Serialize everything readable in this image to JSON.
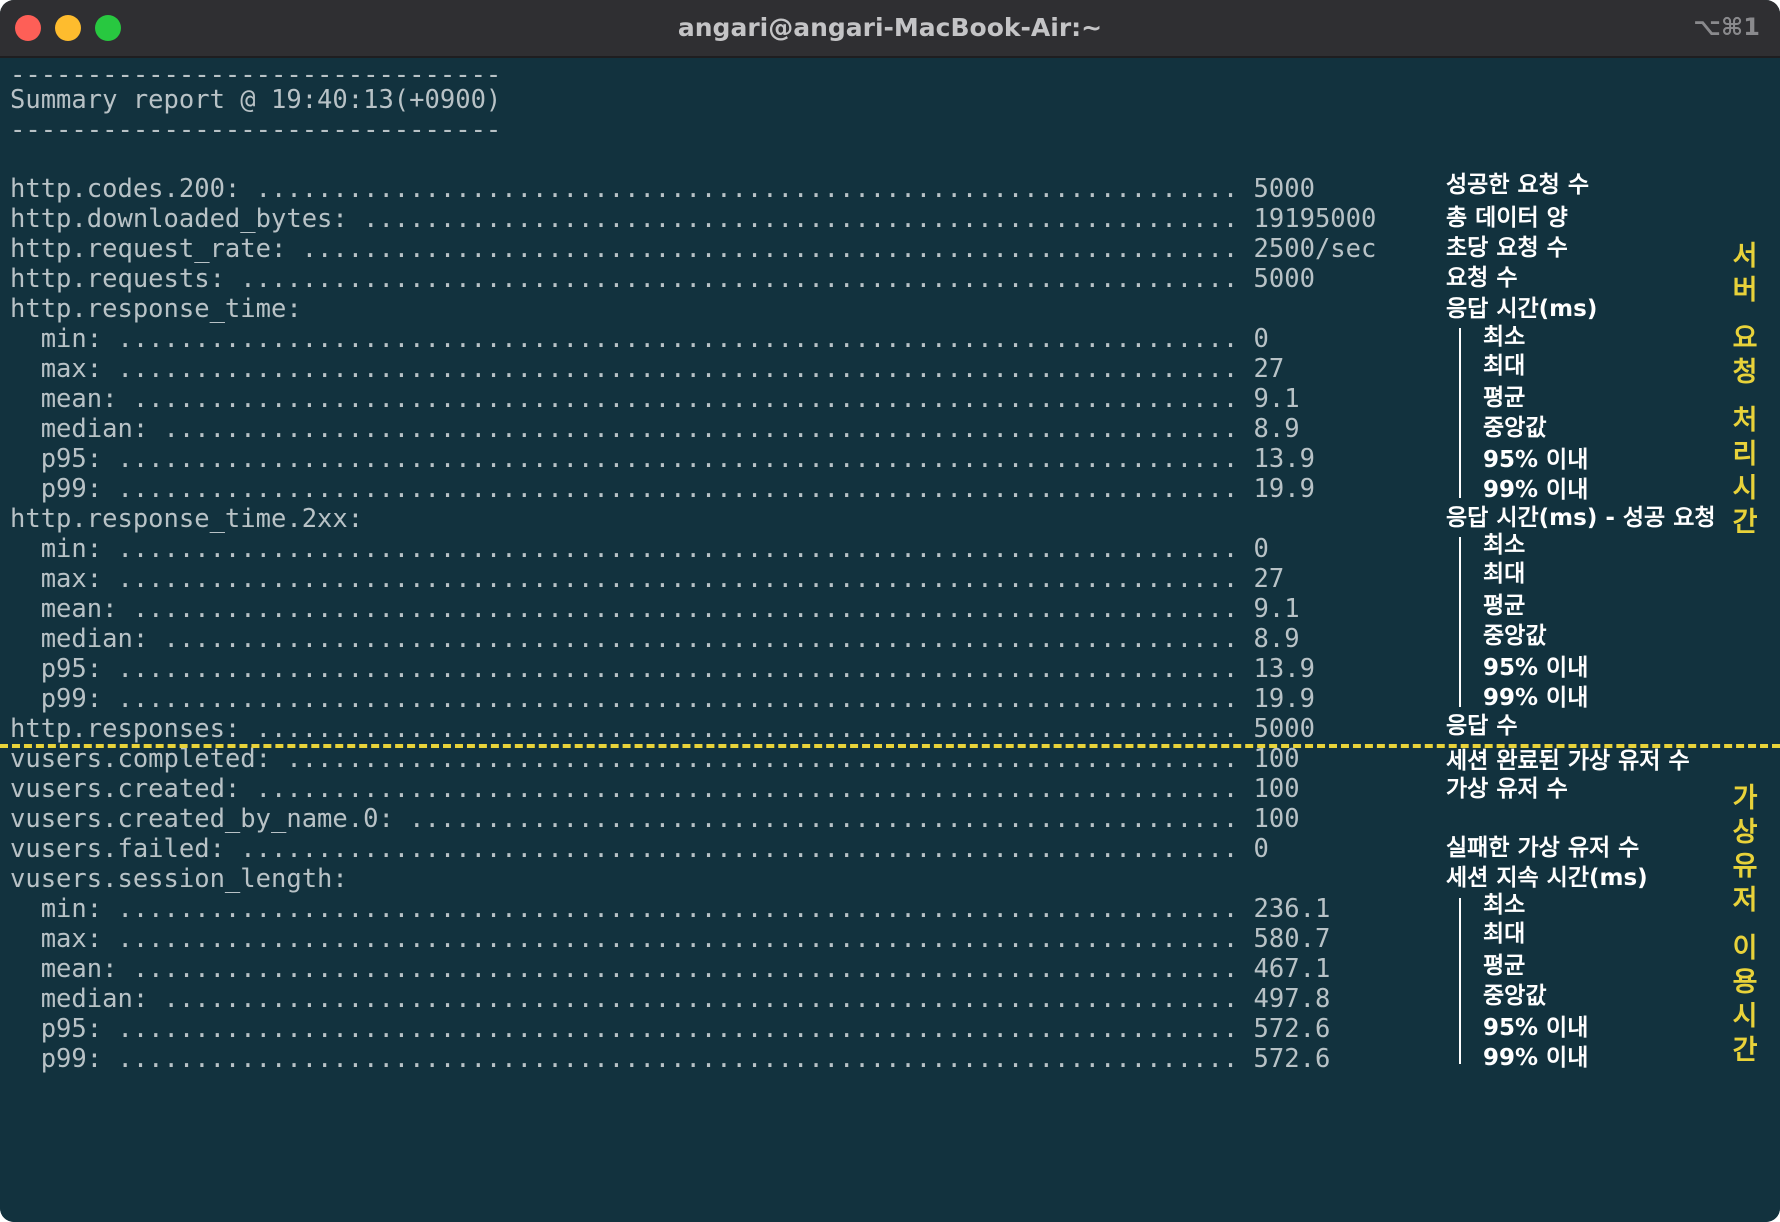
{
  "window": {
    "title": "angari@angari-MacBook-Air:~",
    "shortcut": "⌥⌘1"
  },
  "terminal": {
    "separator": "--------------------------------",
    "summary": "Summary report @ 19:40:13(+0900)",
    "lines": [
      "http.codes.200: ................................................................ 5000",
      "http.downloaded_bytes: ......................................................... 19195000",
      "http.request_rate: ............................................................. 2500/sec",
      "http.requests: ................................................................. 5000",
      "http.response_time:",
      "  min: ......................................................................... 0",
      "  max: ......................................................................... 27",
      "  mean: ........................................................................ 9.1",
      "  median: ...................................................................... 8.9",
      "  p95: ......................................................................... 13.9",
      "  p99: ......................................................................... 19.9",
      "http.response_time.2xx:",
      "  min: ......................................................................... 0",
      "  max: ......................................................................... 27",
      "  mean: ........................................................................ 9.1",
      "  median: ...................................................................... 8.9",
      "  p95: ......................................................................... 13.9",
      "  p99: ......................................................................... 19.9",
      "http.responses: ................................................................ 5000",
      "vusers.completed: .............................................................. 100",
      "vusers.created: ................................................................ 100",
      "vusers.created_by_name.0: ...................................................... 100",
      "vusers.failed: ................................................................. 0",
      "vusers.session_length:",
      "  min: ......................................................................... 236.1",
      "  max: ......................................................................... 580.7",
      "  mean: ........................................................................ 467.1",
      "  median: ...................................................................... 497.8",
      "  p95: ......................................................................... 572.6",
      "  p99: ......................................................................... 572.6"
    ]
  },
  "annotations": {
    "codes200": "성공한 요청 수",
    "downloaded_bytes": "총 데이터 양",
    "request_rate": "초당 요청 수",
    "requests": "요청 수",
    "response_time": "응답 시간(ms)",
    "response_time_2xx": "응답 시간(ms) - 성공 요청",
    "responses": "응답 수",
    "vusers_completed": "세션 완료된 가상 유저 수",
    "vusers_created": "가상 유저 수",
    "vusers_failed": "실패한 가상 유저 수",
    "session_length": "세션 지속 시간(ms)",
    "stats": {
      "min": "최소",
      "max": "최대",
      "mean": "평균",
      "median": "중앙값",
      "p95": "95% 이내",
      "p99": "99% 이내"
    },
    "side_server": [
      "서",
      "버",
      "",
      "요",
      "청",
      "",
      "처",
      "리",
      "시",
      "간"
    ],
    "side_vusers": [
      "가",
      "상",
      "유",
      "저",
      "",
      "이",
      "용",
      "시",
      "간"
    ]
  },
  "colors": {
    "background": "#12323e",
    "text": "#b8c2c6",
    "accent": "#e8d23a"
  }
}
